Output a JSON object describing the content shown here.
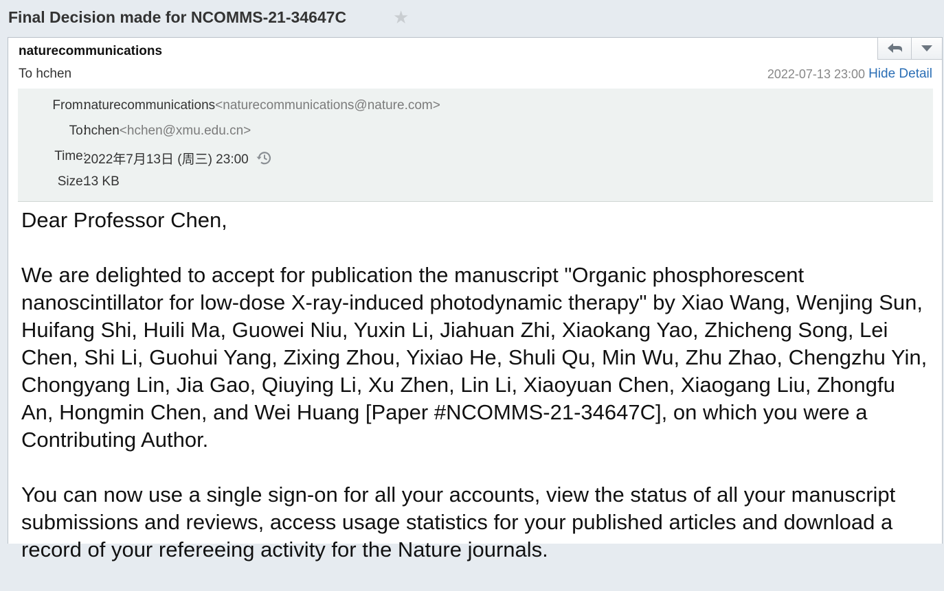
{
  "subject": "Final Decision made for NCOMMS-21-34647C",
  "header": {
    "sender": "naturecommunications",
    "to_line": "To hchen",
    "date": "2022-07-13 23:00",
    "hide_detail": "Hide Detail"
  },
  "details": {
    "from_label": "From:",
    "from_name": "naturecommunications",
    "from_addr": "<naturecommunications@nature.com>",
    "to_label": "To:",
    "to_name": "hchen",
    "to_addr": "<hchen@xmu.edu.cn>",
    "time_label": "Time:",
    "time_value": "2022年7月13日 (周三) 23:00",
    "size_label": "Size:",
    "size_value": "13 KB"
  },
  "icons": {
    "star": "star-icon",
    "reply": "reply-icon",
    "more": "chevron-down-icon",
    "history": "history-icon"
  },
  "colors": {
    "link": "#2a6eb5",
    "detail_bg": "#eef2f1",
    "window_bg": "#e6ebf0"
  },
  "body": {
    "greeting": "Dear Professor Chen,",
    "paragraph1": "We are delighted to accept for publication the manuscript \"Organic phosphorescent nanoscintillator for low-dose X-ray-induced photodynamic therapy\" by Xiao Wang, Wenjing Sun, Huifang Shi, Huili Ma, Guowei Niu, Yuxin Li, Jiahuan Zhi, Xiaokang Yao, Zhicheng Song, Lei Chen, Shi Li, Guohui Yang, Zixing Zhou, Yixiao He, Shuli Qu, Min Wu, Zhu Zhao, Chengzhu Yin, Chongyang Lin, Jia Gao, Qiuying Li, Xu Zhen, Lin Li, Xiaoyuan Chen, Xiaogang Liu, Zhongfu An, Hongmin Chen, and Wei Huang [Paper #NCOMMS-21-34647C], on which you were a Contributing Author.",
    "paragraph2": "You can now use a single sign-on for all your accounts, view the status of all your manuscript submissions and reviews, access usage statistics for your published articles and download a record of your refereeing activity for the Nature journals."
  }
}
